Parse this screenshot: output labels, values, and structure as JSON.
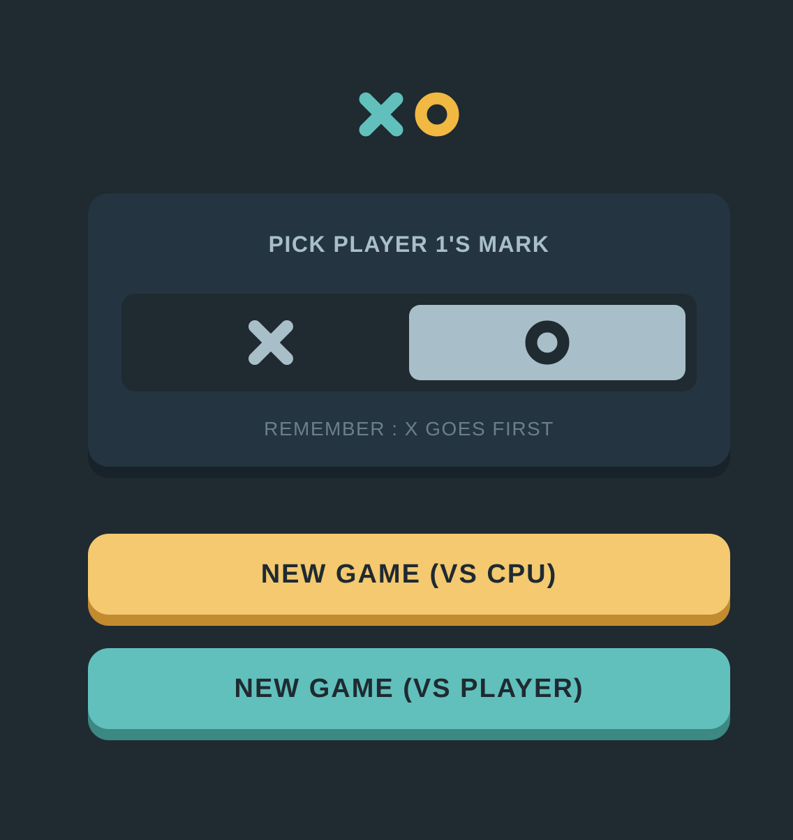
{
  "logo": {
    "x_color": "#61c0bc",
    "o_color": "#f1b941",
    "icons": [
      "x-mark-icon",
      "o-mark-icon"
    ]
  },
  "picker": {
    "title": "PICK PLAYER 1'S MARK",
    "options": [
      {
        "mark": "X",
        "icon": "x-mark-icon",
        "selected": false
      },
      {
        "mark": "O",
        "icon": "o-mark-icon",
        "selected": true
      }
    ],
    "note": "REMEMBER : X GOES FIRST"
  },
  "buttons": {
    "vs_cpu": "NEW GAME (VS CPU)",
    "vs_player": "NEW GAME (VS PLAYER)"
  },
  "colors": {
    "background": "#1f2a31",
    "card": "#243440",
    "silver": "#a8bfc9",
    "yellow": "#f4c96f",
    "teal": "#61c0bc"
  }
}
